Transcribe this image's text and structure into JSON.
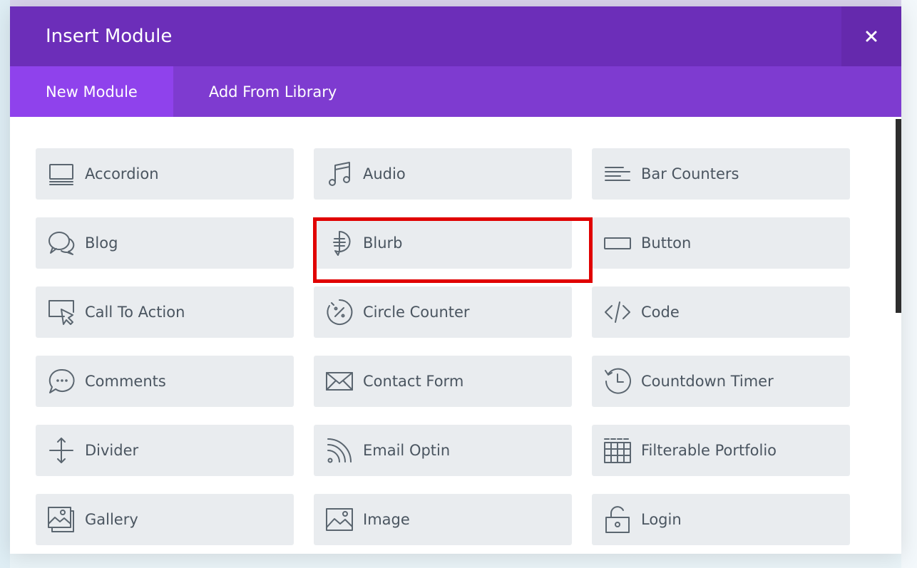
{
  "modal": {
    "title": "Insert Module",
    "close_icon": "close-icon"
  },
  "tabs": [
    {
      "label": "New Module",
      "active": true
    },
    {
      "label": "Add From Library",
      "active": false
    }
  ],
  "modules": [
    {
      "label": "Accordion",
      "icon": "accordion-icon"
    },
    {
      "label": "Audio",
      "icon": "audio-icon"
    },
    {
      "label": "Bar Counters",
      "icon": "bar-counters-icon"
    },
    {
      "label": "Blog",
      "icon": "blog-icon"
    },
    {
      "label": "Blurb",
      "icon": "blurb-icon"
    },
    {
      "label": "Button",
      "icon": "button-icon"
    },
    {
      "label": "Call To Action",
      "icon": "call-to-action-icon"
    },
    {
      "label": "Circle Counter",
      "icon": "circle-counter-icon"
    },
    {
      "label": "Code",
      "icon": "code-icon"
    },
    {
      "label": "Comments",
      "icon": "comments-icon"
    },
    {
      "label": "Contact Form",
      "icon": "contact-form-icon"
    },
    {
      "label": "Countdown Timer",
      "icon": "countdown-timer-icon"
    },
    {
      "label": "Divider",
      "icon": "divider-icon"
    },
    {
      "label": "Email Optin",
      "icon": "email-optin-icon"
    },
    {
      "label": "Filterable Portfolio",
      "icon": "filterable-portfolio-icon"
    },
    {
      "label": "Gallery",
      "icon": "gallery-icon"
    },
    {
      "label": "Image",
      "icon": "image-icon"
    },
    {
      "label": "Login",
      "icon": "login-icon"
    }
  ],
  "highlighted_module": "Blurb",
  "colors": {
    "header": "#6c2eb9",
    "tabs_bar": "#7e3bd0",
    "active_tab": "#8f42ec",
    "module_bg": "#e9ecef",
    "highlight": "#e00000"
  }
}
